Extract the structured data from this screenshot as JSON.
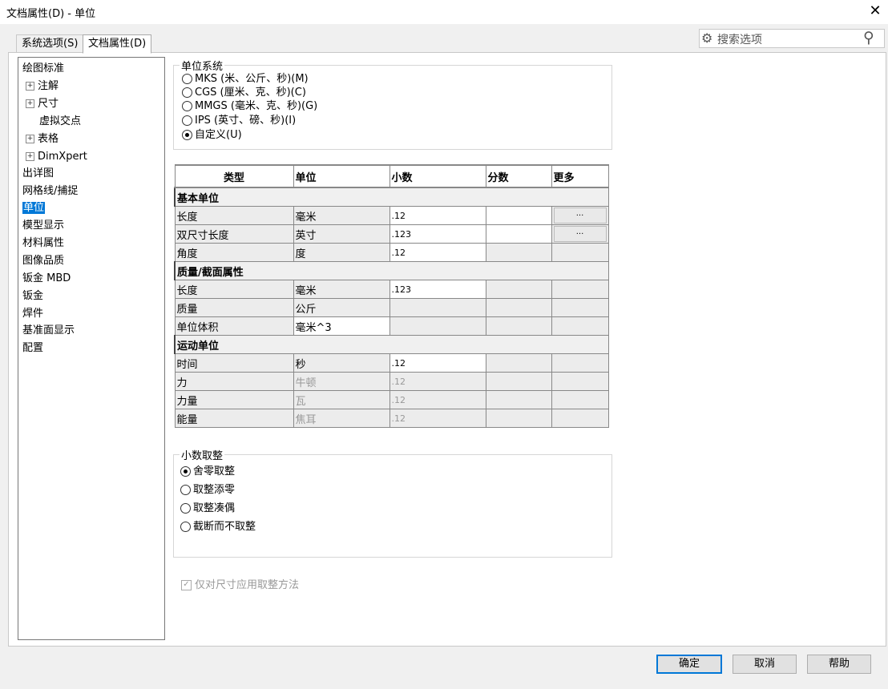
{
  "window": {
    "title": "文档属性(D) - 单位",
    "close_label": "✕"
  },
  "tabs": [
    {
      "label": "系统选项(S)"
    },
    {
      "label": "文档属性(D)"
    }
  ],
  "search": {
    "placeholder": "搜索选项"
  },
  "tree": {
    "items": [
      {
        "label": "绘图标准"
      },
      {
        "label": "注解"
      },
      {
        "label": "尺寸"
      },
      {
        "label": "虚拟交点"
      },
      {
        "label": "表格"
      },
      {
        "label": "DimXpert"
      },
      {
        "label": "出详图"
      },
      {
        "label": "网格线/捕捉"
      },
      {
        "label": "单位"
      },
      {
        "label": "模型显示"
      },
      {
        "label": "材料属性"
      },
      {
        "label": "图像品质"
      },
      {
        "label": "钣金 MBD"
      },
      {
        "label": "钣金"
      },
      {
        "label": "焊件"
      },
      {
        "label": "基准面显示"
      },
      {
        "label": "配置"
      }
    ]
  },
  "unit_system": {
    "title": "单位系统",
    "options": [
      {
        "label": "MKS (米、公斤、秒)(M)",
        "checked": false
      },
      {
        "label": "CGS (厘米、克、秒)(C)",
        "checked": false
      },
      {
        "label": "MMGS (毫米、克、秒)(G)",
        "checked": false
      },
      {
        "label": "IPS (英寸、磅、秒)(I)",
        "checked": false
      },
      {
        "label": "自定义(U)",
        "checked": true
      }
    ]
  },
  "table": {
    "headers": [
      "类型",
      "单位",
      "小数",
      "分数",
      "更多"
    ],
    "more_label": "...",
    "sections": {
      "basic": "基本单位",
      "mass": "质量/截面属性",
      "motion": "运动单位"
    },
    "basic_rows": [
      {
        "type": "长度",
        "unit": "毫米",
        "decimal": ".12"
      },
      {
        "type": "双尺寸长度",
        "unit": "英寸",
        "decimal": ".123"
      },
      {
        "type": "角度",
        "unit": "度",
        "decimal": ".12"
      }
    ],
    "mass_rows": [
      {
        "type": "长度",
        "unit": "毫米",
        "decimal": ".123"
      },
      {
        "type": "质量",
        "unit": "公斤",
        "decimal": ""
      },
      {
        "type": "单位体积",
        "unit": "毫米^3",
        "decimal": ""
      }
    ],
    "motion_rows": [
      {
        "type": "时间",
        "unit": "秒",
        "decimal": ".12"
      },
      {
        "type": "力",
        "unit": "牛顿",
        "decimal": ".12"
      },
      {
        "type": "力量",
        "unit": "瓦",
        "decimal": ".12"
      },
      {
        "type": "能量",
        "unit": "焦耳",
        "decimal": ".12"
      }
    ]
  },
  "rounding": {
    "title": "小数取整",
    "options": [
      {
        "label": "舍零取整",
        "checked": true
      },
      {
        "label": "取整添零",
        "checked": false
      },
      {
        "label": "取整凑偶",
        "checked": false
      },
      {
        "label": "截断而不取整",
        "checked": false
      }
    ],
    "apply_only_dims": "仅对尺寸应用取整方法"
  },
  "buttons": {
    "ok": "确定",
    "cancel": "取消",
    "help": "帮助"
  }
}
